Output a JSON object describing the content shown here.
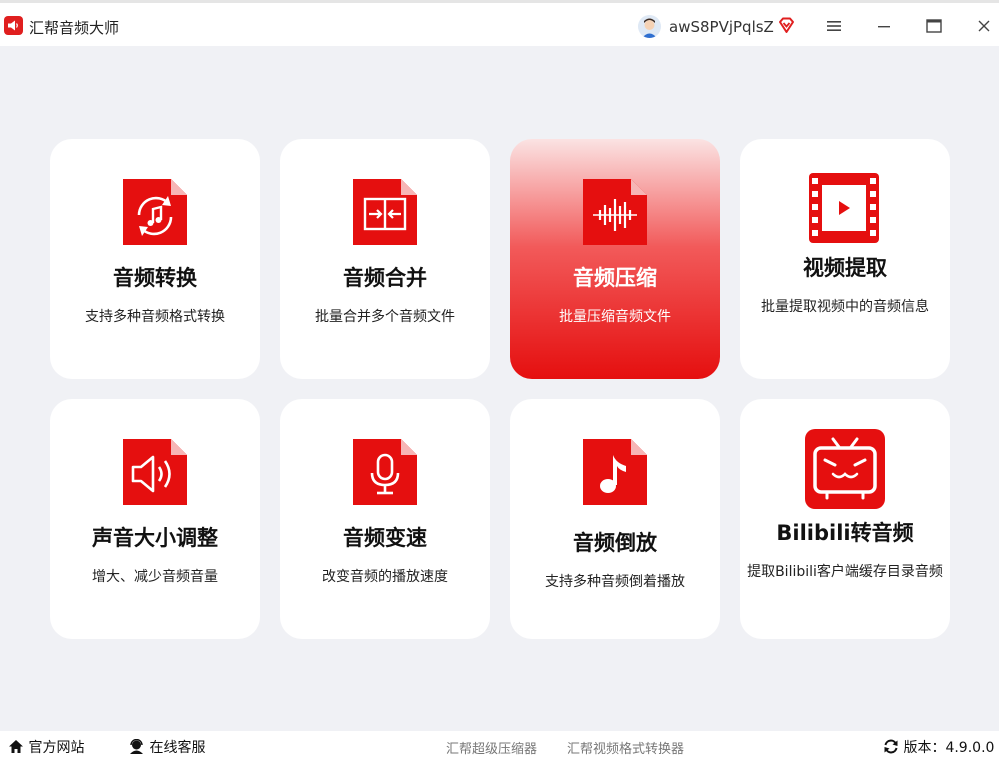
{
  "app": {
    "title": "汇帮音频大师",
    "icon": "speaker-logo-icon"
  },
  "header": {
    "username": "awS8PVjPqlsZ",
    "vip_icon": "vip-diamond-icon",
    "menu_icon": "hamburger-menu-icon",
    "minimize_icon": "minimize-icon",
    "maximize_icon": "maximize-icon",
    "close_icon": "close-icon"
  },
  "cards": [
    {
      "title": "音频转换",
      "desc": "支持多种音频格式转换",
      "icon": "audio-convert-icon"
    },
    {
      "title": "音频合并",
      "desc": "批量合并多个音频文件",
      "icon": "audio-merge-icon"
    },
    {
      "title": "音频压缩",
      "desc": "批量压缩音频文件",
      "icon": "audio-compress-icon",
      "active": true
    },
    {
      "title": "视频提取",
      "desc": "批量提取视频中的音频信息",
      "icon": "video-extract-icon"
    },
    {
      "title": "声音大小调整",
      "desc": "增大、减少音频音量",
      "icon": "volume-adjust-icon"
    },
    {
      "title": "音频变速",
      "desc": "改变音频的播放速度",
      "icon": "microphone-speed-icon"
    },
    {
      "title": "音频倒放",
      "desc": "支持多种音频倒着播放",
      "icon": "music-note-reverse-icon"
    },
    {
      "title": "Bilibili转音频",
      "desc": "提取Bilibili客户端缓存目录音频",
      "icon": "bilibili-tv-icon"
    }
  ],
  "footer": {
    "website": "官方网站",
    "support": "在线客服",
    "link1": "汇帮超级压缩器",
    "link2": "汇帮视频格式转换器",
    "version_label": "版本：",
    "version": "4.9.0.0"
  },
  "colors": {
    "accent": "#e50f0f",
    "background": "#f0f1f5",
    "card": "#ffffff"
  }
}
